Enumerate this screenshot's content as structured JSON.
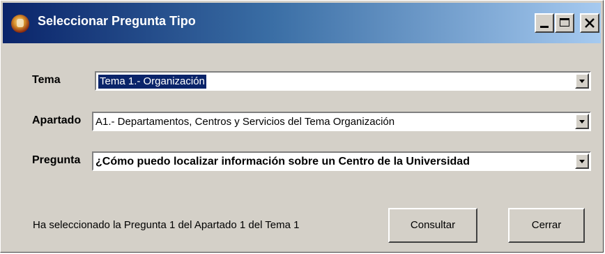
{
  "window": {
    "title": "Seleccionar Pregunta Tipo"
  },
  "form": {
    "tema": {
      "label": "Tema",
      "value": "Tema 1.- Organización"
    },
    "apartado": {
      "label": "Apartado",
      "value": "A1.- Departamentos, Centros y Servicios del Tema Organización"
    },
    "pregunta": {
      "label": "Pregunta",
      "value": "¿Cómo puedo localizar información sobre un Centro de la Universidad"
    }
  },
  "status_text": "Ha seleccionado la Pregunta 1 del Apartado 1 del Tema 1",
  "buttons": {
    "consultar": "Consultar",
    "cerrar": "Cerrar"
  },
  "colors": {
    "titlebar_start": "#0a246a",
    "titlebar_end": "#a6caf0",
    "face": "#d4d0c8",
    "selection": "#0a246a"
  }
}
